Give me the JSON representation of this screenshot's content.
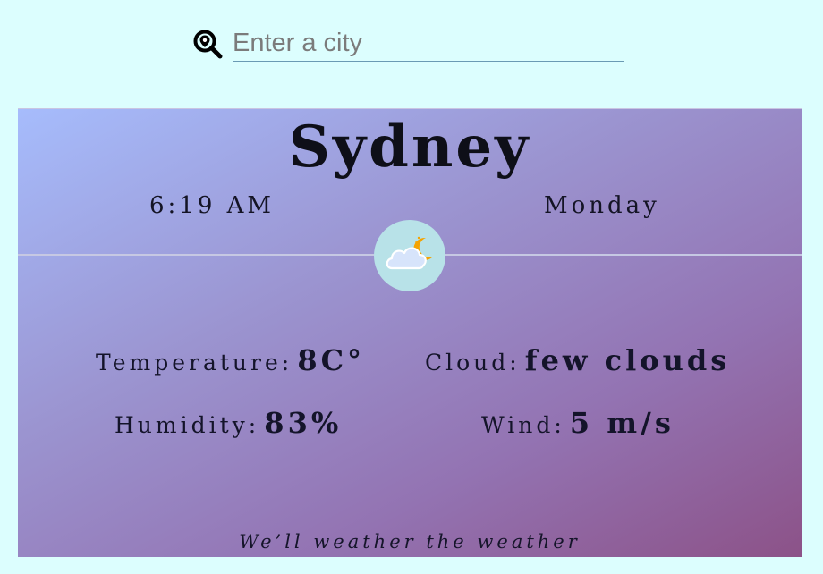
{
  "search": {
    "placeholder": "Enter a city",
    "value": "",
    "icon": "search-location-icon"
  },
  "weather": {
    "city": "Sydney",
    "time": "6:19 AM",
    "day": "Monday",
    "condition_icon": "cloud-moon-icon",
    "temperature_label": "Temperature:",
    "temperature_value": "8C°",
    "cloud_label": "Cloud:",
    "cloud_value": "few clouds",
    "humidity_label": "Humidity:",
    "humidity_value": "83%",
    "wind_label": "Wind:",
    "wind_value": "5 m/s"
  },
  "footer": {
    "tagline": "We’ll weather the weather"
  },
  "colors": {
    "page_background": "#dcfefe",
    "card_gradient_start": "#a6bcfc",
    "card_gradient_end": "#8c5288",
    "icon_circle": "#b8e2e8",
    "moon": "#f5a300"
  }
}
